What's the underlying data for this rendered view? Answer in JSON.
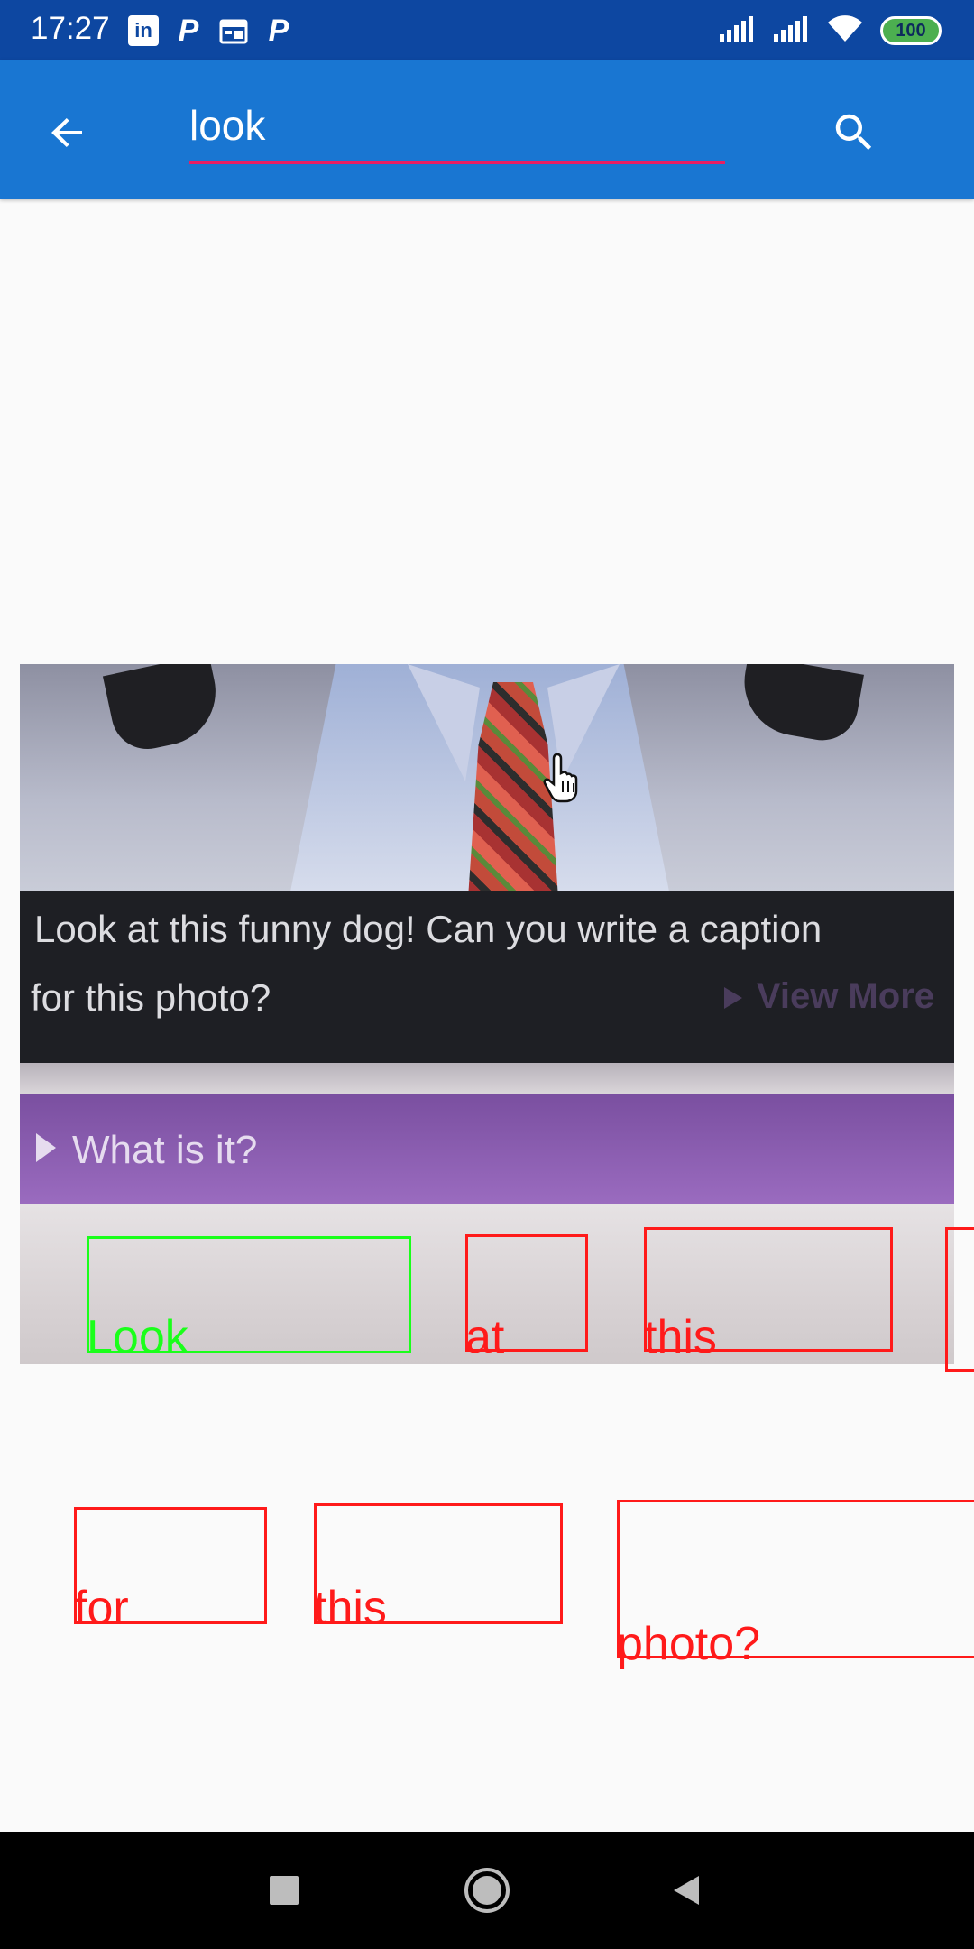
{
  "status_bar": {
    "time": "17:27",
    "battery": "100",
    "left_icons": [
      "linkedin-icon",
      "parking-icon",
      "calendar-icon",
      "parking-icon"
    ],
    "right_icons": [
      "signal-icon",
      "signal-icon",
      "wifi-icon",
      "battery-icon"
    ]
  },
  "app_bar": {
    "search_value": "look",
    "back_icon": "arrow-back-icon",
    "search_icon": "search-icon",
    "colors": {
      "bar": "#1976d2",
      "status": "#0d47a1",
      "underline": "#e91e63"
    }
  },
  "photo": {
    "caption_line1": "Look at this funny dog! Can you write a caption",
    "caption_line2": "for this photo?",
    "view_more": "View More",
    "what_is_it": "What is it?"
  },
  "ocr_words": [
    {
      "text": "Look",
      "selected": true
    },
    {
      "text": "at",
      "selected": false
    },
    {
      "text": "this",
      "selected": false
    },
    {
      "text": "for",
      "selected": false
    },
    {
      "text": "this",
      "selected": false
    },
    {
      "text": "photo?",
      "selected": false
    }
  ],
  "ocr_colors": {
    "match": "#1aff1a",
    "other": "#ff1a1a"
  },
  "nav_bar": {
    "icons": [
      "recents-square-icon",
      "home-circle-icon",
      "back-triangle-icon"
    ]
  }
}
